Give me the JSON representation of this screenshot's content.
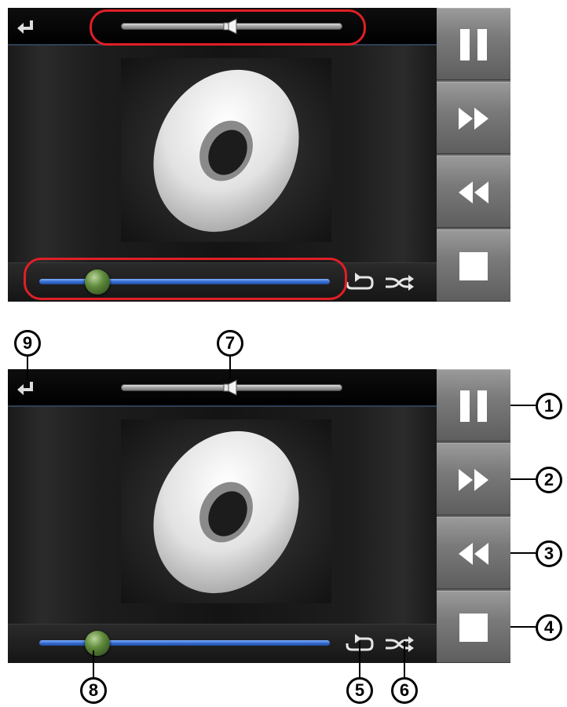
{
  "player": {
    "volume_level_percent": 50,
    "seek_position_percent": 20,
    "side_buttons": [
      {
        "id": "pause",
        "icon": "pause-icon"
      },
      {
        "id": "fast-forward",
        "icon": "fast-forward-icon"
      },
      {
        "id": "rewind",
        "icon": "rewind-icon"
      },
      {
        "id": "stop",
        "icon": "stop-icon"
      }
    ],
    "top_icons": [
      "back-arrow-icon",
      "volume-slider-thumb-icon"
    ],
    "bottom_icons": [
      "repeat-icon",
      "shuffle-icon"
    ],
    "album_art_icon": "disc-icon"
  },
  "callouts": {
    "c1": "1",
    "c2": "2",
    "c3": "3",
    "c4": "4",
    "c5": "5",
    "c6": "6",
    "c7": "7",
    "c8": "8",
    "c9": "9"
  },
  "colors": {
    "highlight_outline": "#e01f26",
    "seek_track_blue": "#3a6fd1",
    "seek_thumb_green": "#5f8a3b",
    "side_button_gray": "#7a7a7a"
  }
}
